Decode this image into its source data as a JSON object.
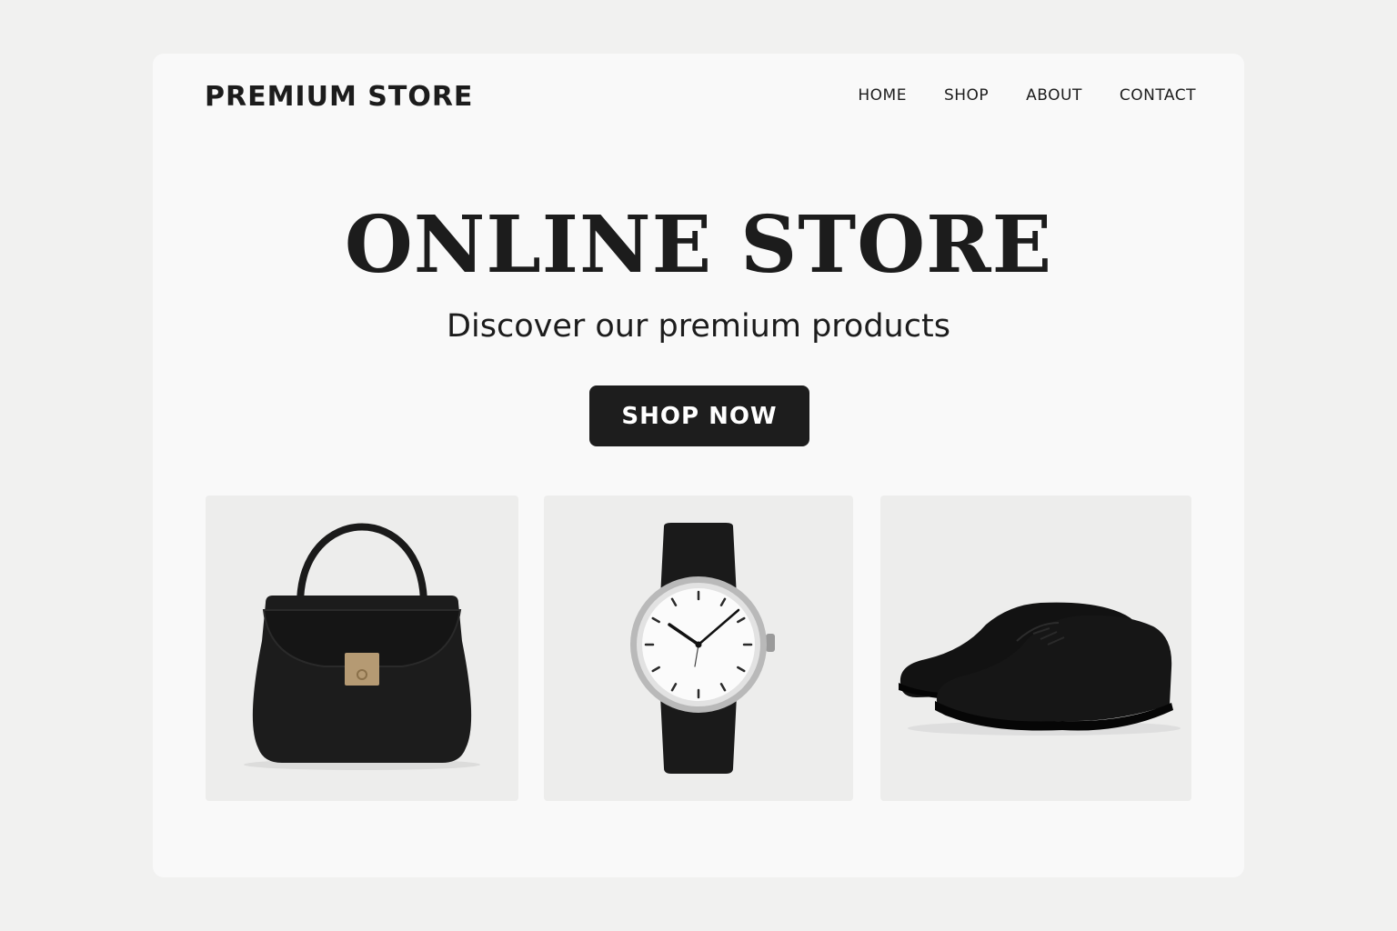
{
  "header": {
    "brand": "PREMIUM STORE",
    "nav": [
      "HOME",
      "SHOP",
      "ABOUT",
      "CONTACT"
    ]
  },
  "hero": {
    "title": "ONLINE STORE",
    "subtitle": "Discover our premium products",
    "cta_label": "SHOP NOW"
  },
  "products": [
    {
      "icon": "handbag-icon"
    },
    {
      "icon": "watch-icon"
    },
    {
      "icon": "shoes-icon"
    }
  ],
  "colors": {
    "page_background": "#f1f1f0",
    "card_background": "#f9f9f9",
    "text": "#1c1c1c",
    "button": "#1d1d1d",
    "product_tile": "#ededec"
  }
}
